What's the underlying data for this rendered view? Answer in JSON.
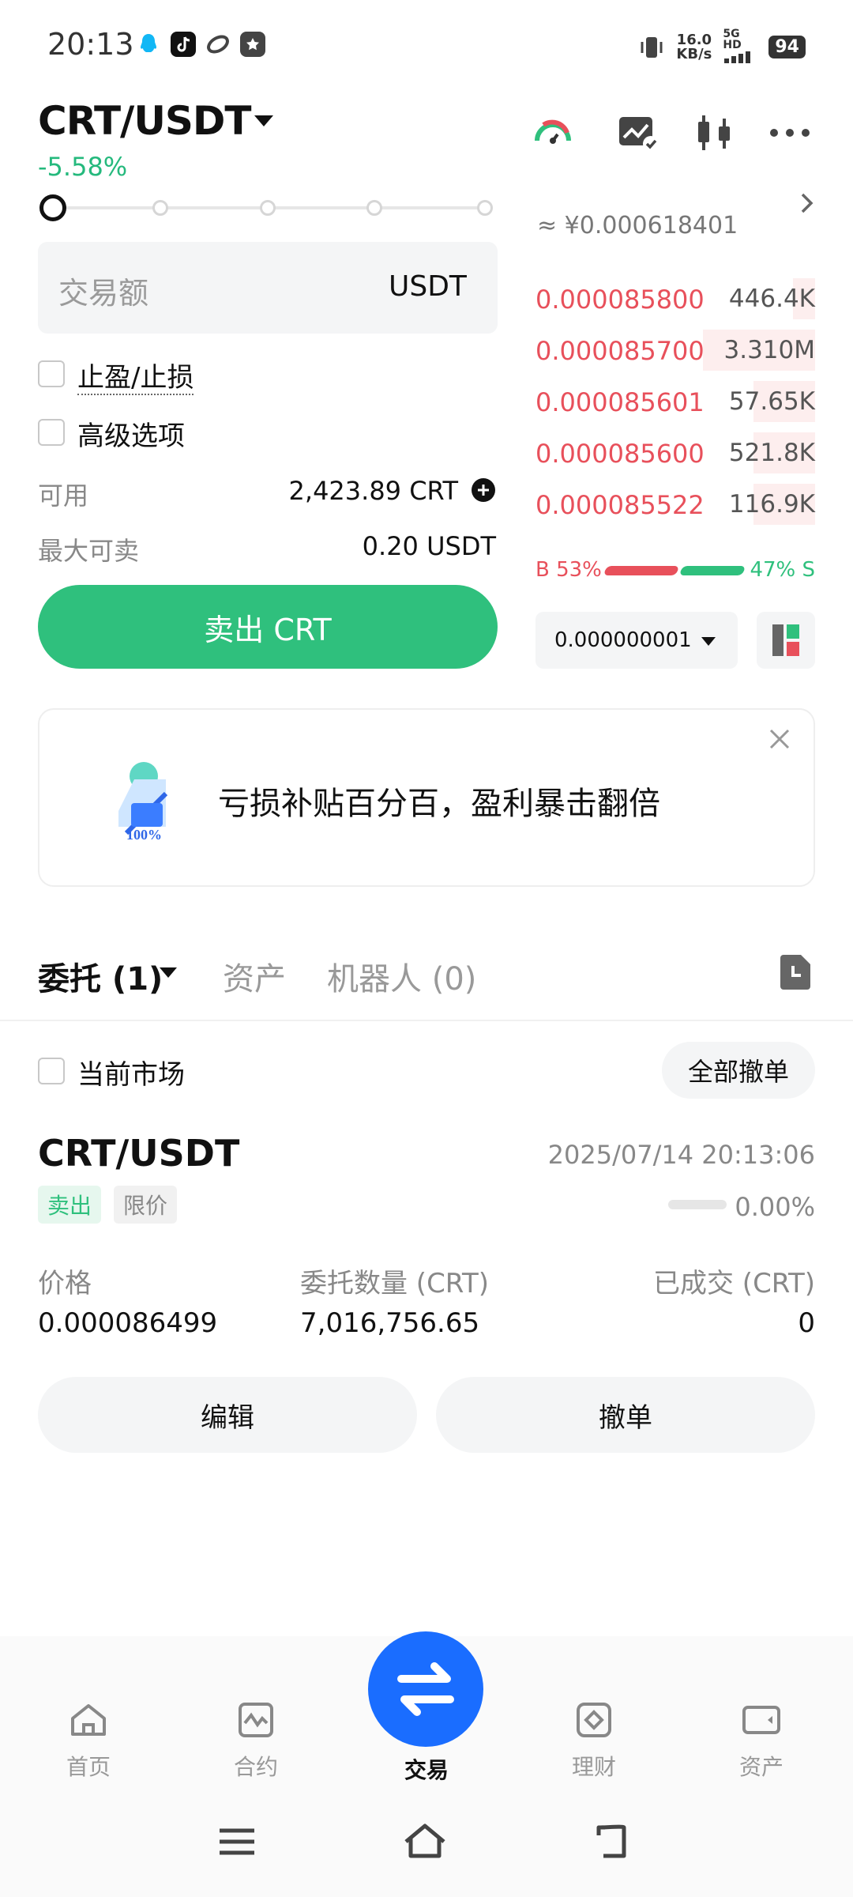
{
  "status_bar": {
    "time": "20:13",
    "net_speed_value": "16.0",
    "net_speed_unit": "KB/s",
    "network": "5G HD",
    "battery": "94"
  },
  "header": {
    "pair": "CRT/USDT",
    "change": "-5.58%"
  },
  "form": {
    "amount_placeholder": "交易额",
    "amount_unit": "USDT",
    "tp_sl_label": "止盈/止损",
    "advanced_label": "高级选项",
    "available_label": "可用",
    "available_value": "2,423.89 CRT",
    "max_sell_label": "最大可卖",
    "max_sell_value": "0.20 USDT",
    "sell_button": "卖出 CRT",
    "slider_level": 0
  },
  "order_book": {
    "ref_price": "≈ ¥0.000618401",
    "asks": [
      {
        "price": "0.000085800",
        "qty": "446.4K",
        "depth": 0.08
      },
      {
        "price": "0.000085700",
        "qty": "3.310M",
        "depth": 0.4
      },
      {
        "price": "0.000085601",
        "qty": "57.65K",
        "depth": 0.22
      },
      {
        "price": "0.000085600",
        "qty": "521.8K",
        "depth": 0.22
      },
      {
        "price": "0.000085522",
        "qty": "116.9K",
        "depth": 0.22
      }
    ],
    "buy_ratio": "B 53%",
    "sell_ratio": "47% S",
    "precision": "0.000000001"
  },
  "promo": {
    "text": "亏损补贴百分百，盈利暴击翻倍",
    "art_label": "100%"
  },
  "tabs": {
    "orders": "委托 (1)",
    "assets": "资产",
    "bots": "机器人 (0)"
  },
  "filter": {
    "current_market": "当前市场",
    "cancel_all": "全部撤单"
  },
  "order": {
    "pair": "CRT/USDT",
    "time": "2025/07/14 20:13:06",
    "side": "卖出",
    "type": "限价",
    "filled_pct": "0.00%",
    "price_label": "价格",
    "price_value": "0.000086499",
    "amount_label": "委托数量 (CRT)",
    "amount_value": "7,016,756.65",
    "filled_label": "已成交 (CRT)",
    "filled_value": "0",
    "edit_button": "编辑",
    "cancel_button": "撤单"
  },
  "bottom_nav": {
    "home": "首页",
    "futures": "合约",
    "trade": "交易",
    "finance": "理财",
    "assets": "资产"
  },
  "colors": {
    "green": "#2fc07d",
    "red": "#e8505b",
    "blue": "#1a6dff"
  }
}
